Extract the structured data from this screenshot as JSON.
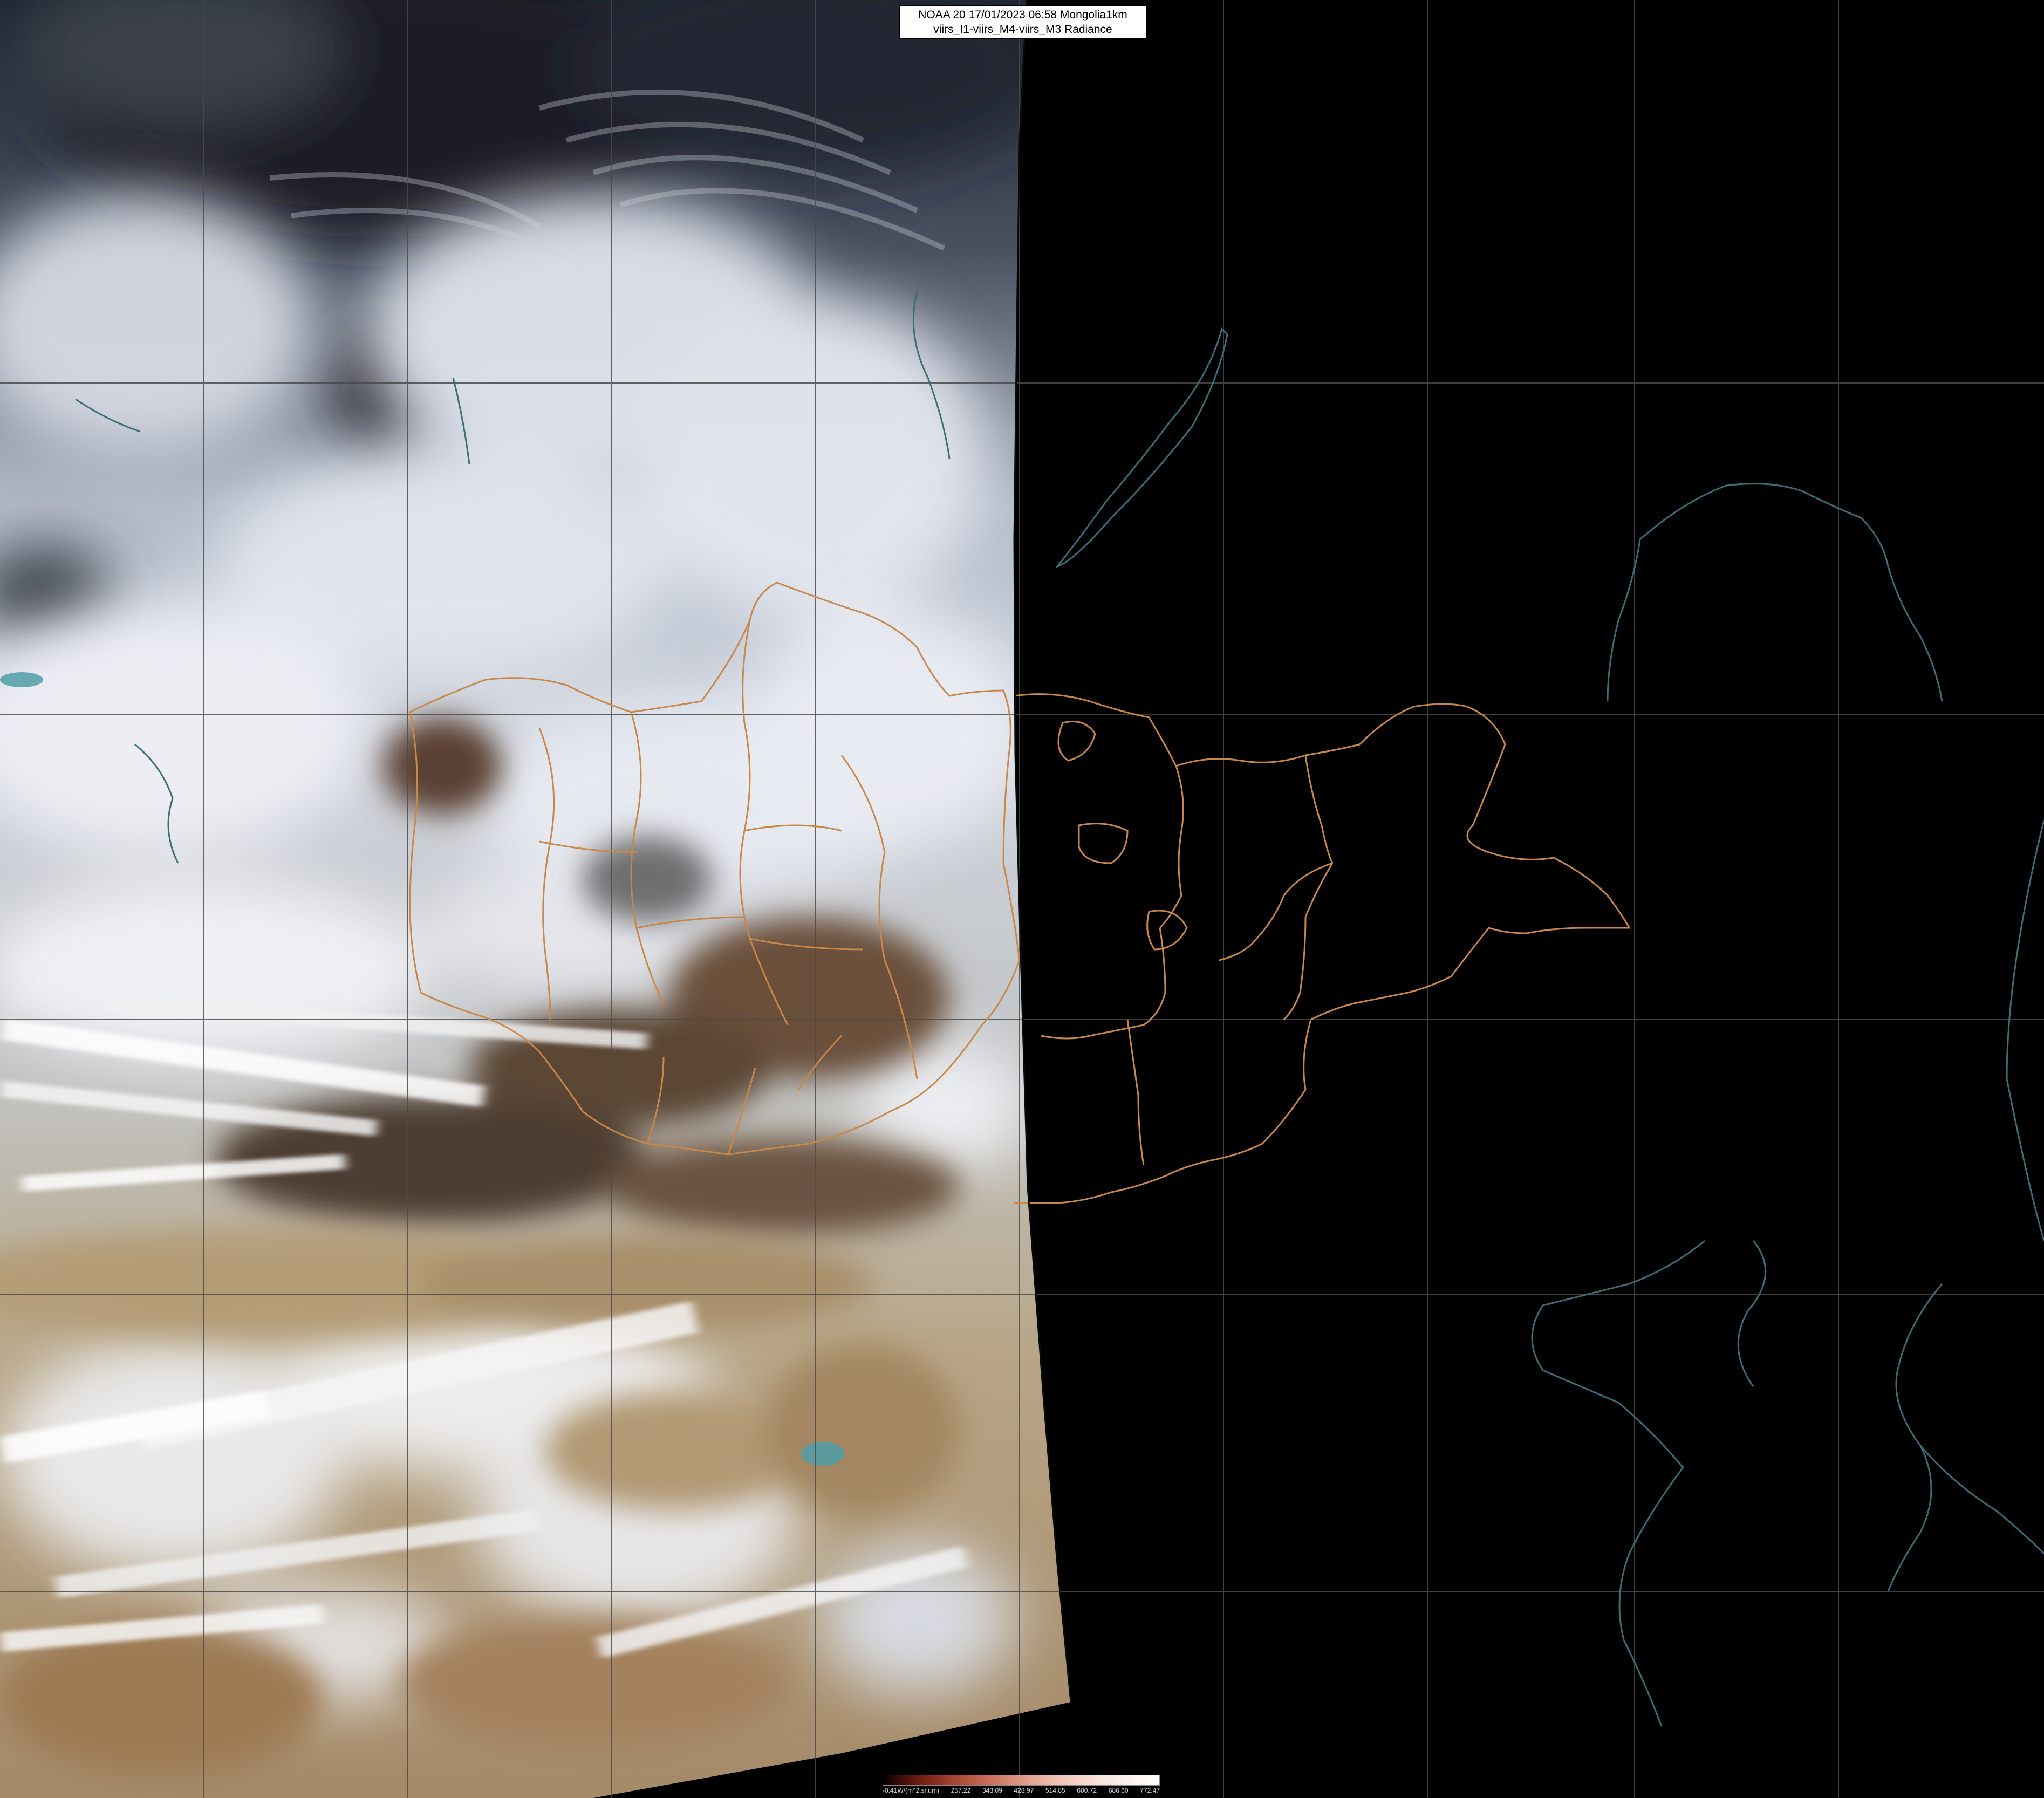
{
  "header": {
    "line1": "NOAA 20 17/01/2023 06:58 Mongolia1km",
    "line2": "viirs_I1-viirs_M4-viirs_M3 Radiance"
  },
  "colorbar": {
    "labels": [
      "-0.41W/(m^2.sr.um)",
      "257.22",
      "343.09",
      "428.97",
      "514.85",
      "600.72",
      "686.60",
      "772.47"
    ],
    "colors": {
      "low": "#000000",
      "mid_dark": "#7d2518",
      "mid": "#d98a74",
      "high": "#ffffff"
    }
  },
  "map": {
    "graticule": "on",
    "colors": {
      "no_data": "#000000",
      "province_borders": "#c8884a",
      "coastlines": "#3d6e78",
      "graticule": "#4a4a4a",
      "cloud": "#e8ebf2",
      "desert": "#b9a27c",
      "terrain_dark": "#5b4636"
    }
  }
}
